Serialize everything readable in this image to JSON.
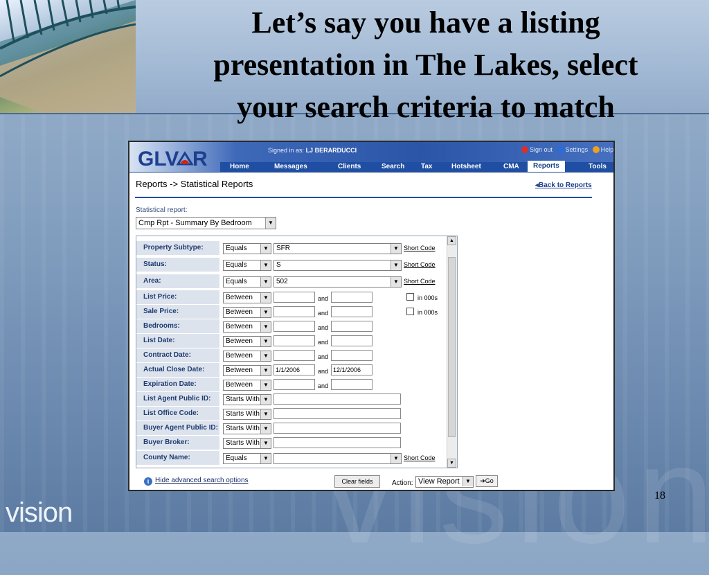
{
  "slide": {
    "title_line1": "Let’s say you have a listing",
    "title_line2": "presentation in The Lakes, select",
    "title_line3": "your search criteria to match",
    "footer_brand": "vision",
    "watermark": "vision",
    "page_number": "18"
  },
  "app": {
    "logo_text": "GLVAR",
    "signed_in_label": "Signed in as:",
    "signed_in_user": "LJ BERARDUCCI",
    "top_links": {
      "sign_out": "Sign out",
      "settings": "Settings",
      "help": "Help"
    },
    "nav_tabs": [
      "Home",
      "Messages",
      "Clients",
      "Search",
      "Tax",
      "Hotsheet",
      "CMA",
      "Reports",
      "Tools"
    ],
    "active_tab": "Reports",
    "breadcrumb": "Reports -> Statistical Reports",
    "back_link": "Back to Reports",
    "stat_report_label": "Statistical report:",
    "stat_report_value": "Cmp Rpt - Summary By Bedroom",
    "criteria": [
      {
        "label": "Property Subtype:",
        "operator": "Equals",
        "value": "SFR",
        "short_code": "Short Code"
      },
      {
        "label": "Status:",
        "operator": "Equals",
        "value": "S",
        "short_code": "Short Code"
      },
      {
        "label": "Area:",
        "operator": "Equals",
        "value": "502",
        "short_code": "Short Code"
      },
      {
        "label": "List Price:",
        "operator": "Between",
        "from": "",
        "to": "",
        "and": "and",
        "checkbox": "in 000s"
      },
      {
        "label": "Sale Price:",
        "operator": "Between",
        "from": "",
        "to": "",
        "and": "and",
        "checkbox": "in 000s"
      },
      {
        "label": "Bedrooms:",
        "operator": "Between",
        "from": "",
        "to": "",
        "and": "and"
      },
      {
        "label": "List Date:",
        "operator": "Between",
        "from": "",
        "to": "",
        "and": "and"
      },
      {
        "label": "Contract Date:",
        "operator": "Between",
        "from": "",
        "to": "",
        "and": "and"
      },
      {
        "label": "Actual Close Date:",
        "operator": "Between",
        "from": "1/1/2006",
        "to": "12/1/2006",
        "and": "and"
      },
      {
        "label": "Expiration Date:",
        "operator": "Between",
        "from": "",
        "to": "",
        "and": "and"
      },
      {
        "label": "List Agent Public ID:",
        "operator": "Starts With",
        "value": ""
      },
      {
        "label": "List Office Code:",
        "operator": "Starts With",
        "value": ""
      },
      {
        "label": "Buyer Agent Public ID:",
        "operator": "Starts With",
        "value": ""
      },
      {
        "label": "Buyer Broker:",
        "operator": "Starts With",
        "value": ""
      },
      {
        "label": "County Name:",
        "operator": "Equals",
        "value": "",
        "short_code": "Short Code"
      }
    ],
    "hide_advanced_link": "Hide advanced search options",
    "clear_button": "Clear fields",
    "action_label": "Action:",
    "action_value": "View Report",
    "go_button": "Go",
    "colors": {
      "nav_blue": "#1f4ea3",
      "label_bg": "#dde3ed",
      "label_text": "#1e3b70"
    }
  }
}
